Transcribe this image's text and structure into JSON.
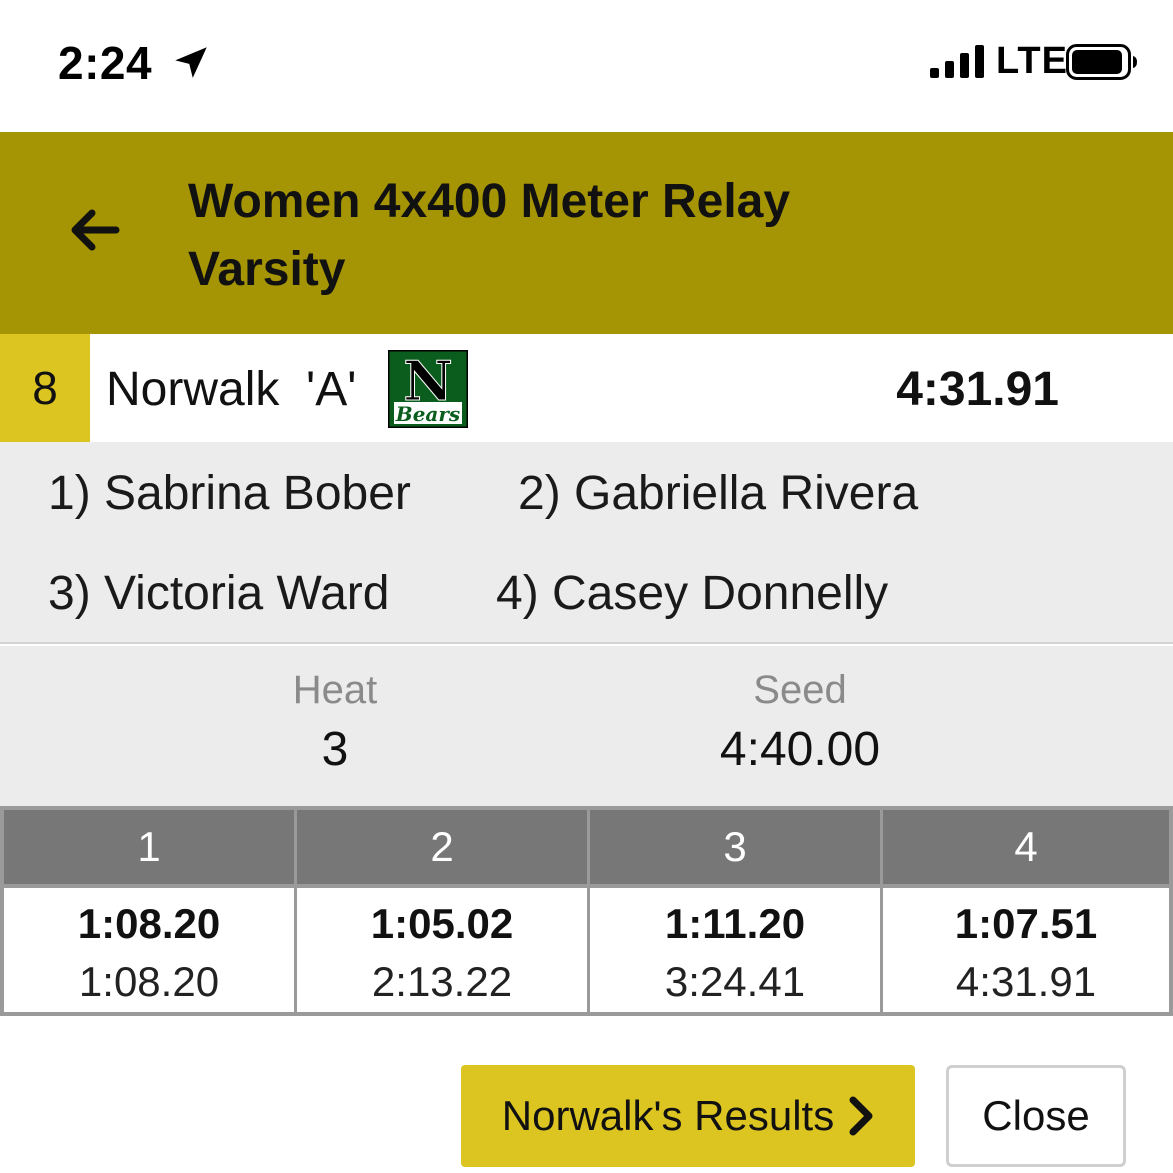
{
  "status_bar": {
    "time": "2:24",
    "network": "LTE"
  },
  "header": {
    "title_line1": "Women 4x400 Meter Relay",
    "title_line2": "Varsity",
    "accent_color": "#a59404"
  },
  "team": {
    "place": "8",
    "name": "Norwalk  'A'",
    "logo_letter": "N",
    "logo_script": "Bears",
    "time": "4:31.91"
  },
  "runners": [
    "1) Sabrina Bober",
    "2) Gabriella Rivera",
    "3) Victoria Ward",
    "4) Casey Donnelly"
  ],
  "info": {
    "heat_label": "Heat",
    "heat_value": "3",
    "seed_label": "Seed",
    "seed_value": "4:40.00"
  },
  "splits": [
    {
      "leg": "1",
      "lap": "1:08.20",
      "cumulative": "1:08.20"
    },
    {
      "leg": "2",
      "lap": "1:05.02",
      "cumulative": "2:13.22"
    },
    {
      "leg": "3",
      "lap": "1:11.20",
      "cumulative": "3:24.41"
    },
    {
      "leg": "4",
      "lap": "1:07.51",
      "cumulative": "4:31.91"
    }
  ],
  "buttons": {
    "results_label": "Norwalk's Results",
    "close_label": "Close",
    "button_color": "#ddc521"
  }
}
